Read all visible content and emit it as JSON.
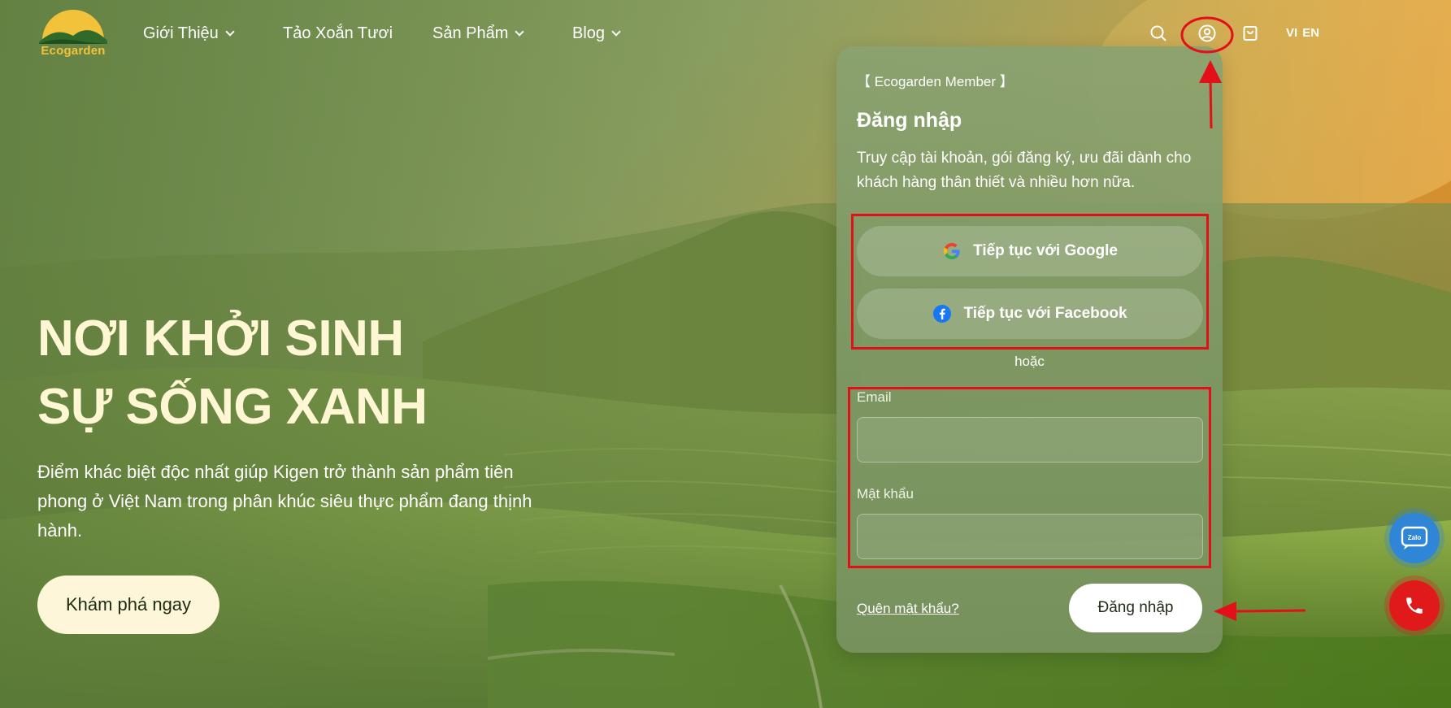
{
  "brand": {
    "name": "Ecogarden",
    "accent": "#f2c33a"
  },
  "nav": [
    {
      "label": "Giới Thiệu",
      "has_dropdown": true
    },
    {
      "label": "Tảo Xoắn Tươi",
      "has_dropdown": false
    },
    {
      "label": "Sản Phẩm",
      "has_dropdown": true
    },
    {
      "label": "Blog",
      "has_dropdown": true
    }
  ],
  "header_icons": [
    "search-icon",
    "user-account-icon",
    "shopping-bag-icon"
  ],
  "languages": [
    "VI",
    "EN"
  ],
  "hero": {
    "title_line1": "NƠI KHỞI SINH",
    "title_line2": "SỰ SỐNG XANH",
    "description": "Điểm khác biệt độc nhất giúp Kigen trở thành sản phẩm tiên phong ở Việt Nam trong phân khúc siêu thực phẩm đang thịnh hành.",
    "cta": "Khám phá ngay"
  },
  "login_panel": {
    "member_label": "【 Ecogarden Member 】",
    "title": "Đăng nhập",
    "subtitle": "Truy cập tài khoản, gói đăng ký, ưu đãi dành cho khách hàng thân thiết và nhiều hơn nữa.",
    "google_button": "Tiếp tục với Google",
    "facebook_button": "Tiếp tục với Facebook",
    "or_text": "hoặc",
    "email_label": "Email",
    "email_value": "",
    "password_label": "Mật khẩu",
    "password_value": "",
    "forgot_link": "Quên mật khẩu?",
    "submit_button": "Đăng nhập"
  },
  "floating": {
    "zalo_label": "Zalo",
    "phone_icon": "phone-icon"
  },
  "colors": {
    "hero_title": "#fff6d3",
    "cta_bg": "#fdf6d9",
    "annotation": "#e3101a",
    "zalo": "#2f86d6",
    "phone": "#e01a1a"
  }
}
